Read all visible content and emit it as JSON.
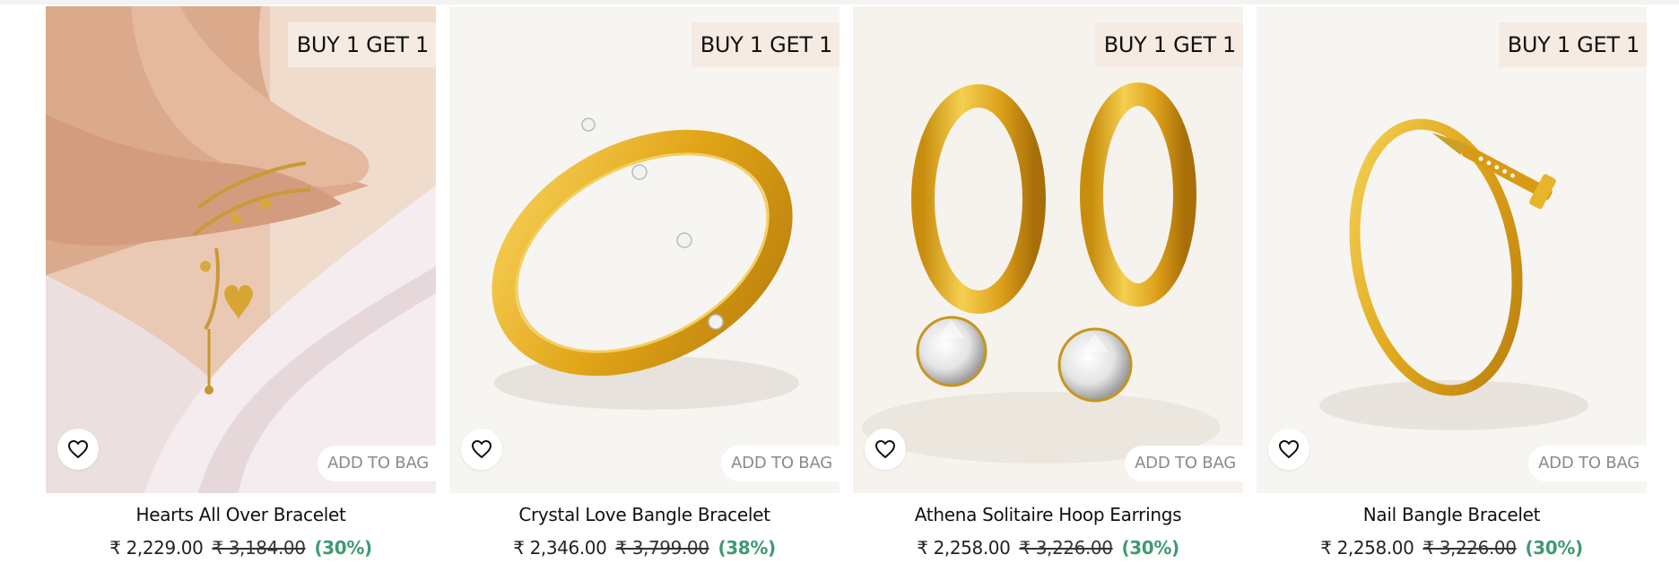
{
  "products": [
    {
      "name": "Hearts All Over Bracelet",
      "badge": "BUY 1 GET 1",
      "price": "₹ 2,229.00",
      "mrp": "₹ 3,184.00",
      "discount": "(30%)",
      "add_to_bag": "ADD TO BAG",
      "wishlist_icon": "heart-outline-icon"
    },
    {
      "name": "Crystal Love Bangle Bracelet",
      "badge": "BUY 1 GET 1",
      "price": "₹ 2,346.00",
      "mrp": "₹ 3,799.00",
      "discount": "(38%)",
      "add_to_bag": "ADD TO BAG",
      "wishlist_icon": "heart-outline-icon"
    },
    {
      "name": "Athena Solitaire Hoop Earrings",
      "badge": "BUY 1 GET 1",
      "price": "₹ 2,258.00",
      "mrp": "₹ 3,226.00",
      "discount": "(30%)",
      "add_to_bag": "ADD TO BAG",
      "wishlist_icon": "heart-outline-icon"
    },
    {
      "name": "Nail Bangle Bracelet",
      "badge": "BUY 1 GET 1",
      "price": "₹ 2,258.00",
      "mrp": "₹ 3,226.00",
      "discount": "(30%)",
      "add_to_bag": "ADD TO BAG",
      "wishlist_icon": "heart-outline-icon"
    }
  ],
  "colors": {
    "badge_bg": "#f5ebe3",
    "discount": "#3f9a72",
    "gold": "#d9a21a"
  }
}
